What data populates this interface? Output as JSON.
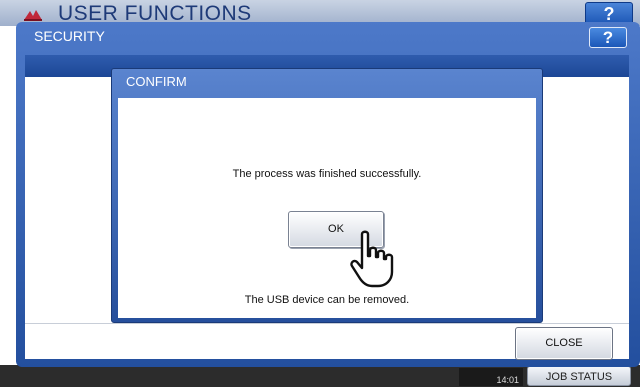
{
  "header": {
    "title": "USER FUNCTIONS",
    "help_label": "?"
  },
  "security_dialog": {
    "title": "SECURITY",
    "help_label": "?",
    "close_label": "CLOSE"
  },
  "confirm_dialog": {
    "title": "CONFIRM",
    "message": "The process was finished successfully.",
    "ok_label": "OK",
    "note": "The USB device can be removed."
  },
  "status_bar": {
    "time": "14:01",
    "job_status_label": "JOB STATUS"
  },
  "icons": {
    "logo": "logo-icon",
    "pointer": "hand-pointer-icon"
  },
  "colors": {
    "dialog_blue": "#234f9e",
    "title_blue": "#1e3a78"
  }
}
